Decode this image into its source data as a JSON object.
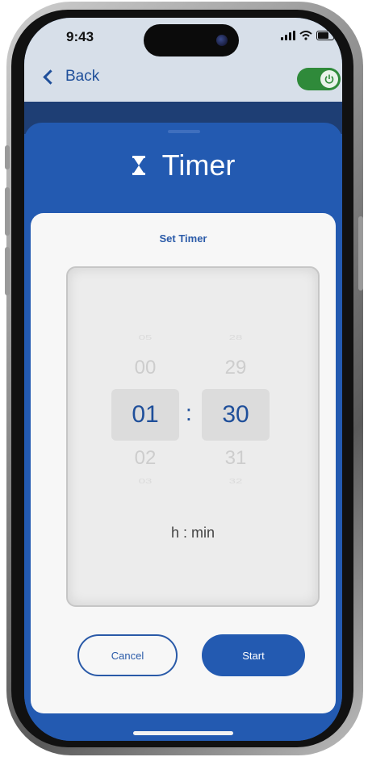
{
  "status": {
    "time": "9:43"
  },
  "nav": {
    "back_label": "Back",
    "power_on": true
  },
  "sheet": {
    "title": "Timer",
    "icon": "hourglass-icon"
  },
  "card": {
    "title": "Set Timer"
  },
  "picker": {
    "hours": {
      "far_above": "05",
      "above": "00",
      "selected": "01",
      "below": "02",
      "far_below": "03"
    },
    "minutes": {
      "far_above": "28",
      "above": "29",
      "selected": "30",
      "below": "31",
      "far_below": "32"
    },
    "separator": ":",
    "unit_label": "h : min"
  },
  "actions": {
    "cancel_label": "Cancel",
    "start_label": "Start"
  },
  "colors": {
    "primary": "#235ab1",
    "accent_text": "#1f4f9a",
    "toggle_on": "#2f8a3a",
    "card_bg": "#f7f7f7"
  }
}
